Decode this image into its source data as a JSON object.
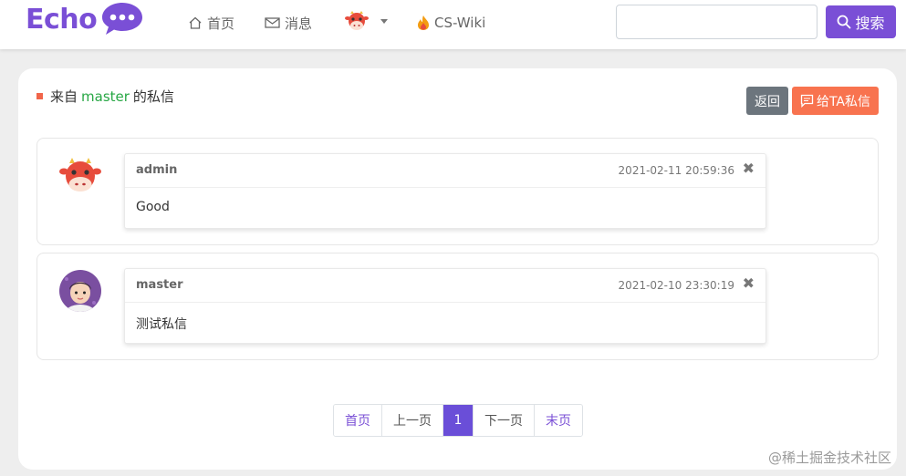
{
  "navbar": {
    "brand": "Echo",
    "home_label": "首页",
    "messages_label": "消息",
    "wiki_label": "CS-Wiki",
    "search_placeholder": "",
    "search_button": "搜索"
  },
  "page": {
    "title_prefix": "来自",
    "title_user": "master",
    "title_suffix": "的私信",
    "back_button": "返回",
    "send_button": "给TA私信"
  },
  "letters": [
    {
      "sender": "admin",
      "time": "2021-02-11 20:59:36",
      "content": "Good",
      "close": "✖"
    },
    {
      "sender": "master",
      "time": "2021-02-10 23:30:19",
      "content": "测试私信",
      "close": "✖"
    }
  ],
  "pagination": {
    "first": "首页",
    "prev": "上一页",
    "current": "1",
    "next": "下一页",
    "last": "末页"
  },
  "watermark": "@稀土掘金技术社区",
  "colors": {
    "brand": "#7a4fd6",
    "accent_orange": "#f8734f",
    "highlight_green": "#28a745",
    "secondary": "#6c757d"
  }
}
